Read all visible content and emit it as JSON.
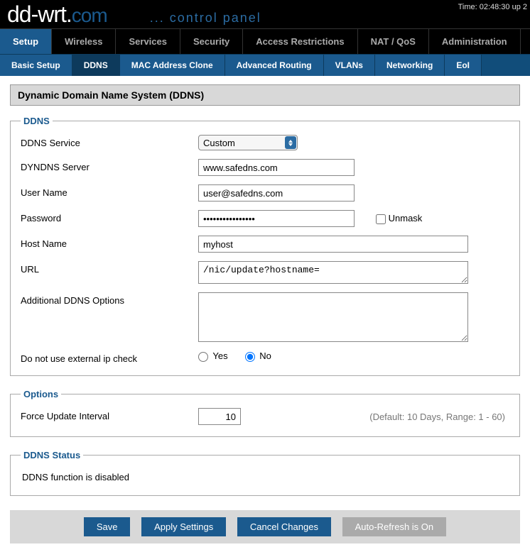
{
  "header": {
    "time": "Time: 02:48:30 up 2",
    "logo_main": "dd-wrt",
    "logo_dot": ".",
    "logo_com": "com",
    "logo_sub": "... control panel"
  },
  "main_tabs": [
    {
      "label": "Setup",
      "active": true
    },
    {
      "label": "Wireless",
      "active": false
    },
    {
      "label": "Services",
      "active": false
    },
    {
      "label": "Security",
      "active": false
    },
    {
      "label": "Access Restrictions",
      "active": false
    },
    {
      "label": "NAT / QoS",
      "active": false
    },
    {
      "label": "Administration",
      "active": false
    }
  ],
  "sub_tabs": [
    {
      "label": "Basic Setup",
      "active": false
    },
    {
      "label": "DDNS",
      "active": true
    },
    {
      "label": "MAC Address Clone",
      "active": false
    },
    {
      "label": "Advanced Routing",
      "active": false
    },
    {
      "label": "VLANs",
      "active": false
    },
    {
      "label": "Networking",
      "active": false
    },
    {
      "label": "EoI",
      "active": false
    }
  ],
  "section_title": "Dynamic Domain Name System (DDNS)",
  "ddns": {
    "legend": "DDNS",
    "service_label": "DDNS Service",
    "service_value": "Custom",
    "server_label": "DYNDNS Server",
    "server_value": "www.safedns.com",
    "user_label": "User Name",
    "user_value": "user@safedns.com",
    "password_label": "Password",
    "password_value": "••••••••••••••••",
    "unmask_label": "Unmask",
    "host_label": "Host Name",
    "host_value": "myhost",
    "url_label": "URL",
    "url_value": "/nic/update?hostname=",
    "addl_label": "Additional DDNS Options",
    "addl_value": "",
    "extip_label": "Do not use external ip check",
    "yes_label": "Yes",
    "no_label": "No"
  },
  "options": {
    "legend": "Options",
    "interval_label": "Force Update Interval",
    "interval_value": "10",
    "interval_hint": "(Default: 10 Days, Range: 1 - 60)"
  },
  "status": {
    "legend": "DDNS Status",
    "text": "DDNS function is disabled"
  },
  "buttons": {
    "save": "Save",
    "apply": "Apply Settings",
    "cancel": "Cancel Changes",
    "auto": "Auto-Refresh is On"
  }
}
